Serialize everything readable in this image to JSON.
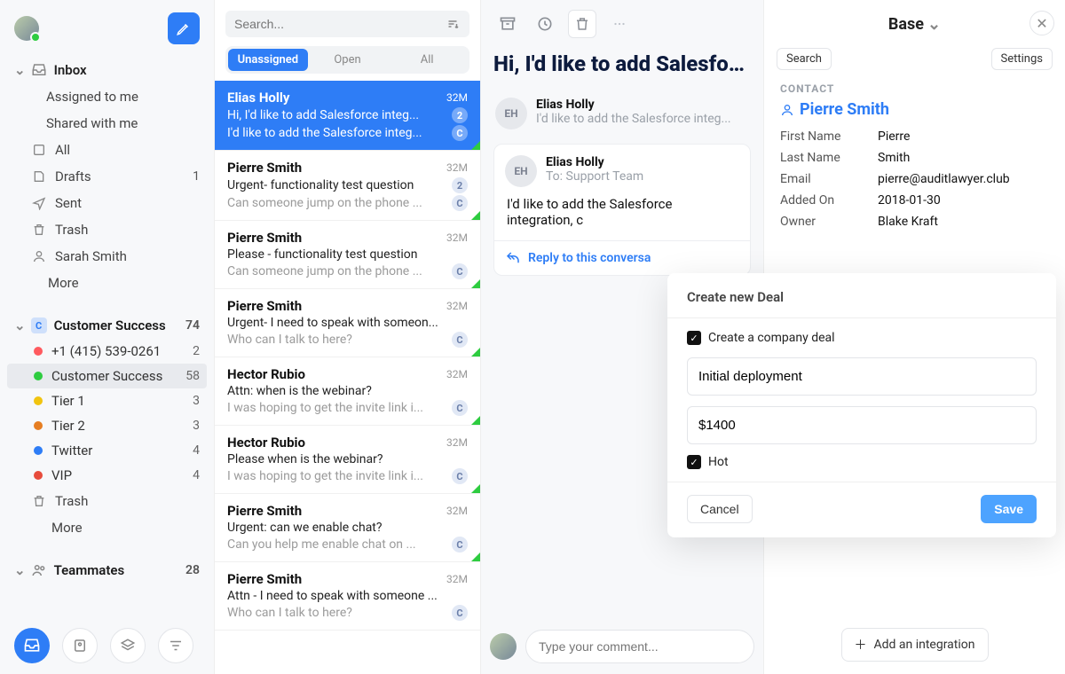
{
  "sidebar": {
    "compose_label": "Compose",
    "inbox": {
      "label": "Inbox",
      "assigned": "Assigned to me",
      "shared": "Shared with me"
    },
    "items": [
      {
        "icon": "all",
        "label": "All",
        "count": ""
      },
      {
        "icon": "drafts",
        "label": "Drafts",
        "count": "1"
      },
      {
        "icon": "sent",
        "label": "Sent",
        "count": ""
      },
      {
        "icon": "trash",
        "label": "Trash",
        "count": ""
      },
      {
        "icon": "person",
        "label": "Sarah Smith",
        "count": ""
      },
      {
        "icon": "",
        "label": "More",
        "count": ""
      }
    ],
    "cs_section": {
      "label": "Customer Success",
      "count": "74",
      "tags": [
        {
          "color": "#ff5a5f",
          "label": "+1 (415) 539-0261",
          "count": "2"
        },
        {
          "color": "#2ecc40",
          "label": "Customer Success",
          "count": "58",
          "selected": true
        },
        {
          "color": "#f1c40f",
          "label": "Tier 1",
          "count": "3"
        },
        {
          "color": "#e67e22",
          "label": "Tier 2",
          "count": "3"
        },
        {
          "color": "#2e7df6",
          "label": "Twitter",
          "count": "4"
        },
        {
          "color": "#e74c3c",
          "label": "VIP",
          "count": "4"
        }
      ],
      "trash": "Trash",
      "more": "More"
    },
    "teammates": {
      "label": "Teammates",
      "count": "28"
    }
  },
  "list": {
    "search_placeholder": "Search...",
    "tabs": [
      "Unassigned",
      "Open",
      "All"
    ],
    "active_tab": 0,
    "conversations": [
      {
        "selected": true,
        "sender": "Elias Holly",
        "time": "32M",
        "subject": "Hi, I'd like to add Salesforce integ...",
        "preview": "I'd like to add the Salesforce integ...",
        "chip1": "2",
        "chip2": "C",
        "accent": true
      },
      {
        "sender": "Pierre Smith",
        "time": "32M",
        "subject": "Urgent- functionality test question",
        "preview": "Can someone jump on the phone ...",
        "chip1": "2",
        "chip2": "C",
        "accent": true
      },
      {
        "sender": "Pierre Smith",
        "time": "32M",
        "subject": "Please - functionality test question",
        "preview": "Can someone jump on the phone ...",
        "chip2": "C",
        "accent": true
      },
      {
        "sender": "Pierre Smith",
        "time": "32M",
        "subject": "Urgent- I need to speak with someon...",
        "preview": "Who can I talk to here?",
        "chip2": "C",
        "accent": true
      },
      {
        "sender": "Hector Rubio",
        "time": "32M",
        "subject": "Attn: when is the webinar?",
        "preview": "I was hoping to get the invite link i...",
        "chip2": "C",
        "accent": true
      },
      {
        "sender": "Hector Rubio",
        "time": "32M",
        "subject": "Please when is the webinar?",
        "preview": "I was hoping to get the invite link i...",
        "chip2": "C",
        "accent": true
      },
      {
        "sender": "Pierre Smith",
        "time": "32M",
        "subject": "Urgent: can we enable chat?",
        "preview": "Can you help me enable chat on ...",
        "chip2": "C",
        "accent": true
      },
      {
        "sender": "Pierre Smith",
        "time": "32M",
        "subject": "Attn - I need to speak with someone ...",
        "preview": "Who can I talk to here?",
        "chip2": "C"
      }
    ]
  },
  "thread": {
    "title": "Hi, I'd like to add Salesforce",
    "preview_msg": {
      "initials": "EH",
      "name": "Elias Holly",
      "sub": "I'd like to add the Salesforce integ..."
    },
    "main_msg": {
      "initials": "EH",
      "name": "Elias Holly",
      "to_label": "To:",
      "to": "Support Team",
      "body": "I'd like to add the Salesforce integration, c"
    },
    "reply_label": "Reply to this conversa",
    "comment_placeholder": "Type your comment..."
  },
  "right": {
    "title": "Base",
    "search": "Search",
    "settings": "Settings",
    "section": "CONTACT",
    "contact_name": "Pierre Smith",
    "rows": [
      {
        "k": "First Name",
        "v": "Pierre"
      },
      {
        "k": "Last Name",
        "v": "Smith"
      },
      {
        "k": "Email",
        "v": "pierre@auditlawyer.club"
      },
      {
        "k": "Added On",
        "v": "2018-01-30"
      },
      {
        "k": "Owner",
        "v": "Blake Kraft"
      }
    ],
    "add_integration": "Add an integration"
  },
  "modal": {
    "title": "Create new Deal",
    "company_deal": "Create a company deal",
    "deal_name": "Initial deployment",
    "deal_amount": "$1400",
    "hot": "Hot",
    "cancel": "Cancel",
    "save": "Save"
  }
}
